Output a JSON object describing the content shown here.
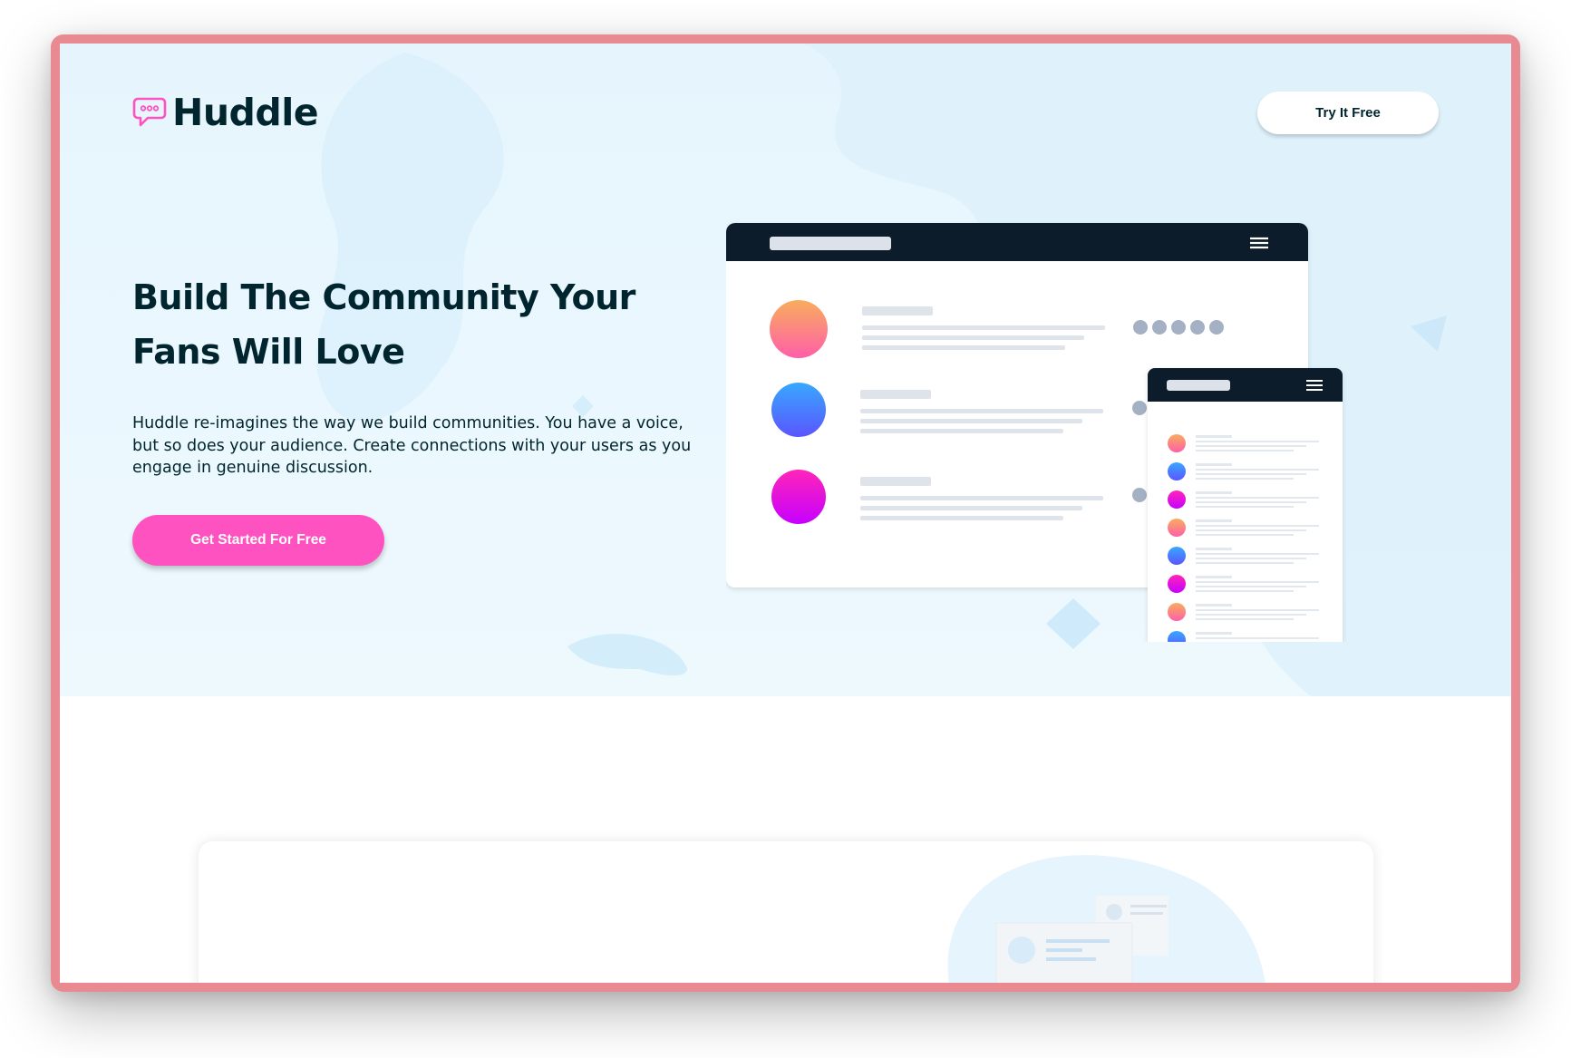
{
  "header": {
    "logo_text": "Huddle",
    "cta_label": "Try It Free"
  },
  "hero": {
    "title": "Build The Community Your Fans Will Love",
    "description": "Huddle re-imagines the way we build communities. You have a voice, but so does your audience. Create connections with your users as you engage in genuine discussion.",
    "cta_label": "Get Started For Free"
  },
  "colors": {
    "brand_dark": "#00252e",
    "accent_pink": "#ff52c1",
    "hero_background": "#e6f5fd",
    "frame": "#e98a93"
  },
  "icons": {
    "logo": "speech-bubble-icon",
    "menu": "hamburger-icon"
  }
}
